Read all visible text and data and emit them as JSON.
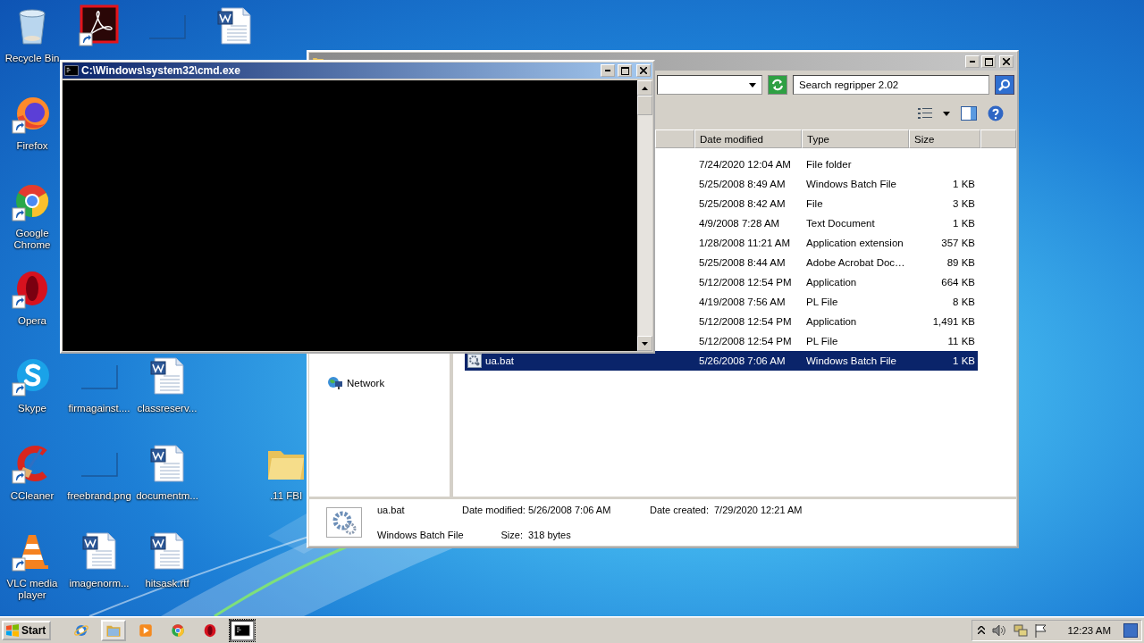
{
  "desktop": {
    "icons": [
      {
        "label": "Recycle Bin",
        "kind": "recycle",
        "shortcut": false
      },
      {
        "label": "Firefox",
        "kind": "firefox",
        "shortcut": true
      },
      {
        "label": "Google Chrome",
        "kind": "chrome",
        "shortcut": true
      },
      {
        "label": "Opera",
        "kind": "opera",
        "shortcut": true
      },
      {
        "label": "Skype",
        "kind": "skype",
        "shortcut": true
      },
      {
        "label": "CCleaner",
        "kind": "ccleaner",
        "shortcut": true
      },
      {
        "label": "VLC media player",
        "kind": "vlc",
        "shortcut": true
      },
      {
        "kind": "acrobat",
        "shortcut": true
      },
      {
        "label": "firmagainst....",
        "kind": "image",
        "shortcut": false
      },
      {
        "label": "freebrand.png",
        "kind": "image",
        "shortcut": false
      },
      {
        "label": "imagenorm...",
        "kind": "word",
        "shortcut": false
      },
      {
        "kind": "image",
        "shortcut": false
      },
      {
        "label": "classreserv...",
        "kind": "word",
        "shortcut": false
      },
      {
        "label": "documentm...",
        "kind": "word",
        "shortcut": false
      },
      {
        "label": "hitsask.rtf",
        "kind": "word",
        "shortcut": false
      },
      {
        "kind": "word",
        "shortcut": false
      },
      {
        "label": ".11 FBI",
        "kind": "folder",
        "shortcut": false
      }
    ]
  },
  "explorer": {
    "search": {
      "placeholder": "Search regripper 2.02"
    },
    "columns": [
      "Date modified",
      "Type",
      "Size"
    ],
    "nav": [
      {
        "label": "Network"
      }
    ],
    "rows": [
      {
        "date": "7/24/2020 12:04 AM",
        "type": "File folder",
        "selected": false
      },
      {
        "date": "5/25/2008 8:49 AM",
        "type": "Windows Batch File",
        "size": "1 KB",
        "selected": false
      },
      {
        "date": "5/25/2008 8:42 AM",
        "type": "File",
        "size": "3 KB",
        "selected": false
      },
      {
        "date": "4/9/2008 7:28 AM",
        "type": "Text Document",
        "size": "1 KB",
        "selected": false
      },
      {
        "date": "1/28/2008 11:21 AM",
        "type": "Application extension",
        "size": "357 KB",
        "selected": false
      },
      {
        "date": "5/25/2008 8:44 AM",
        "type": "Adobe Acrobat Doc…",
        "size": "89 KB",
        "selected": false
      },
      {
        "date": "5/12/2008 12:54 PM",
        "type": "Application",
        "size": "664 KB",
        "selected": false
      },
      {
        "date": "4/19/2008 7:56 AM",
        "type": "PL File",
        "size": "8 KB",
        "selected": false
      },
      {
        "date": "5/12/2008 12:54 PM",
        "type": "Application",
        "size": "1,491 KB",
        "selected": false
      },
      {
        "date": "5/12/2008 12:54 PM",
        "type": "PL File",
        "size": "11 KB",
        "selected": false
      },
      {
        "name": "ua.bat",
        "date": "5/26/2008 7:06 AM",
        "type": "Windows Batch File",
        "size": "1 KB",
        "selected": true
      }
    ],
    "details": {
      "name": "ua.bat",
      "type": "Windows Batch File",
      "modified_label": "Date modified:",
      "modified": "5/26/2008 7:06 AM",
      "created_label": "Date created:",
      "created": "7/29/2020 12:21 AM",
      "size_label": "Size:",
      "size": "318 bytes"
    }
  },
  "cmd_window": {
    "title": "C:\\Windows\\system32\\cmd.exe"
  },
  "taskbar": {
    "start": "Start",
    "apps": [
      {
        "kind": "ie",
        "open": false,
        "selected": false
      },
      {
        "kind": "explorer",
        "open": true,
        "selected": false
      },
      {
        "kind": "media",
        "open": false,
        "selected": false
      },
      {
        "kind": "chrome",
        "open": false,
        "selected": false
      },
      {
        "kind": "opera",
        "open": false,
        "selected": false
      },
      {
        "kind": "cmd",
        "open": true,
        "selected": true
      }
    ],
    "clock": "12:23 AM"
  }
}
